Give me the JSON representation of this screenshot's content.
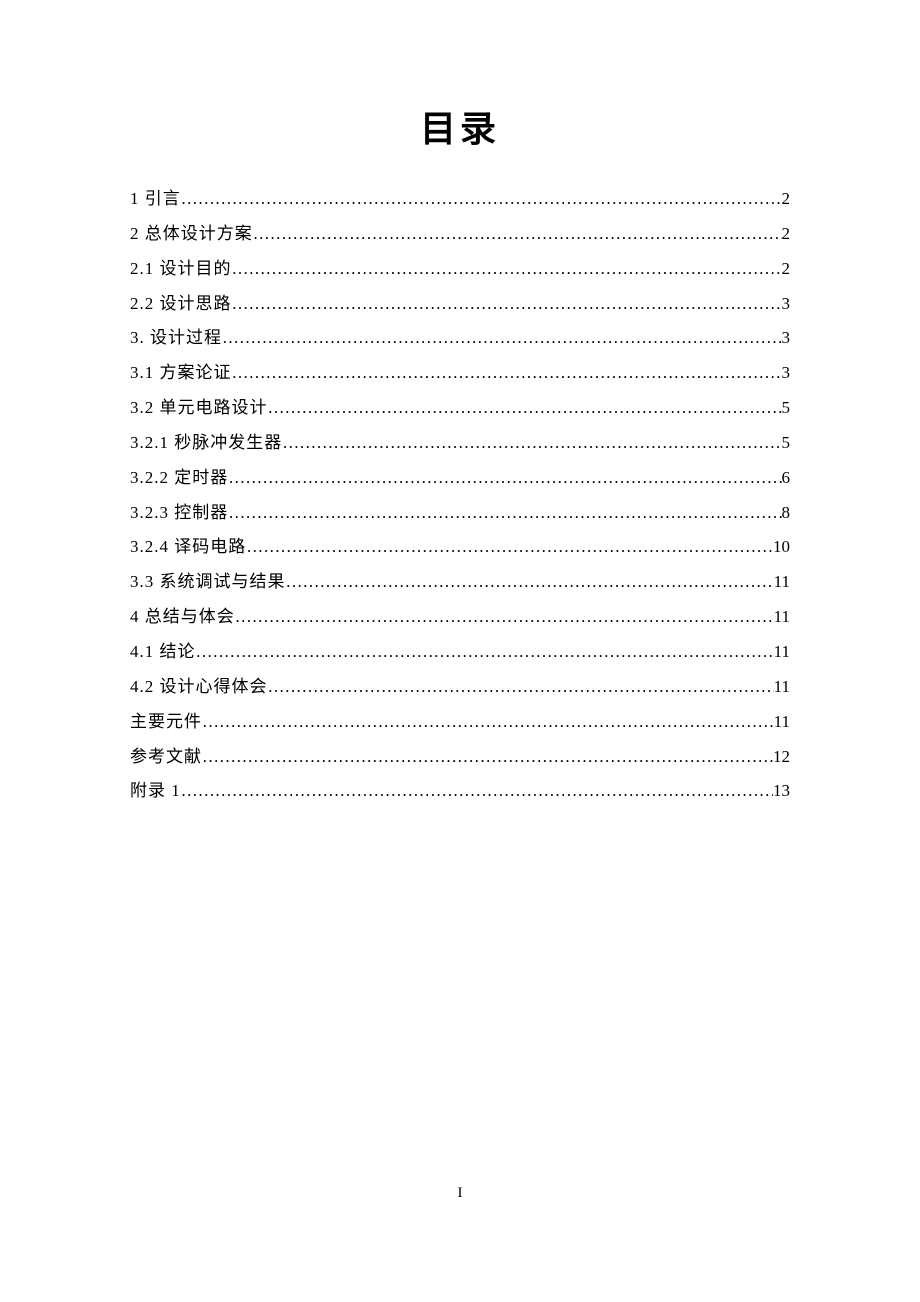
{
  "title": "目录",
  "toc": [
    {
      "label": "1 引言",
      "page": "2"
    },
    {
      "label": "2 总体设计方案",
      "page": "2"
    },
    {
      "label": "2.1 设计目的",
      "page": "2"
    },
    {
      "label": "2.2 设计思路",
      "page": "3"
    },
    {
      "label": "3. 设计过程",
      "page": "3"
    },
    {
      "label": "3.1 方案论证",
      "page": "3"
    },
    {
      "label": "3.2 单元电路设计",
      "page": "5"
    },
    {
      "label": "3.2.1 秒脉冲发生器",
      "page": "5"
    },
    {
      "label": "3.2.2 定时器",
      "page": "6"
    },
    {
      "label": "3.2.3 控制器",
      "page": "8"
    },
    {
      "label": "3.2.4 译码电路",
      "page": "10"
    },
    {
      "label": "3.3 系统调试与结果",
      "page": "11"
    },
    {
      "label": "4 总结与体会",
      "page": "11"
    },
    {
      "label": "4.1 结论",
      "page": "11"
    },
    {
      "label": "4.2 设计心得体会",
      "page": "11"
    },
    {
      "label": "主要元件",
      "page": "11"
    },
    {
      "label": "参考文献",
      "page": "12"
    },
    {
      "label": "附录 1",
      "page": "13"
    }
  ],
  "pageNumber": "I"
}
